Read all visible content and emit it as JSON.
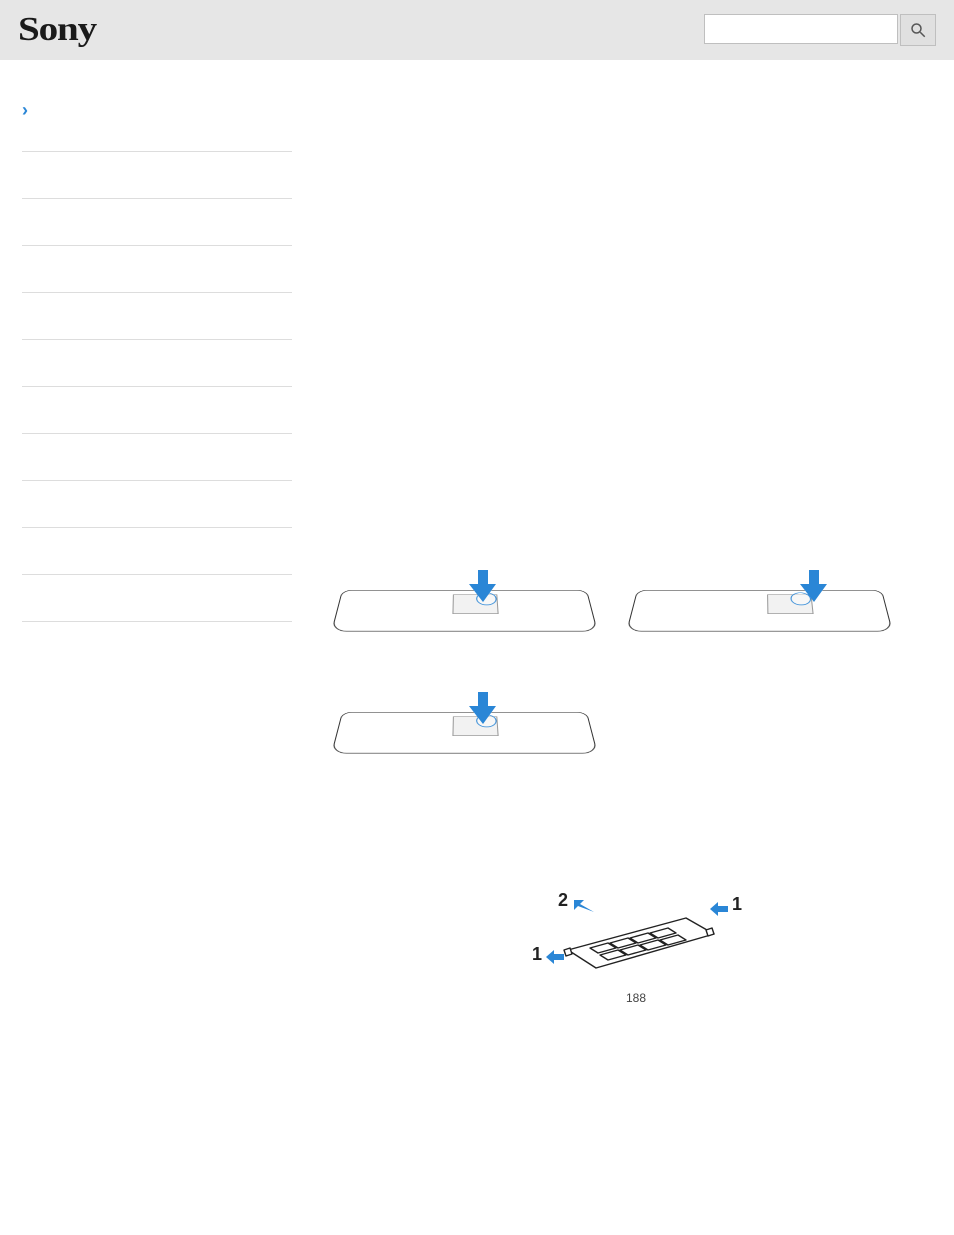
{
  "header": {
    "logo_text": "Sony",
    "search_placeholder": ""
  },
  "sidebar": {
    "chevron": "›",
    "items": [
      {
        "label": ""
      },
      {
        "label": ""
      },
      {
        "label": ""
      },
      {
        "label": ""
      },
      {
        "label": ""
      },
      {
        "label": ""
      },
      {
        "label": ""
      },
      {
        "label": ""
      },
      {
        "label": ""
      },
      {
        "label": ""
      }
    ]
  },
  "figure": {
    "mem_labels": {
      "one_a": "1",
      "one_b": "1",
      "two": "2"
    }
  },
  "page_number": "188"
}
